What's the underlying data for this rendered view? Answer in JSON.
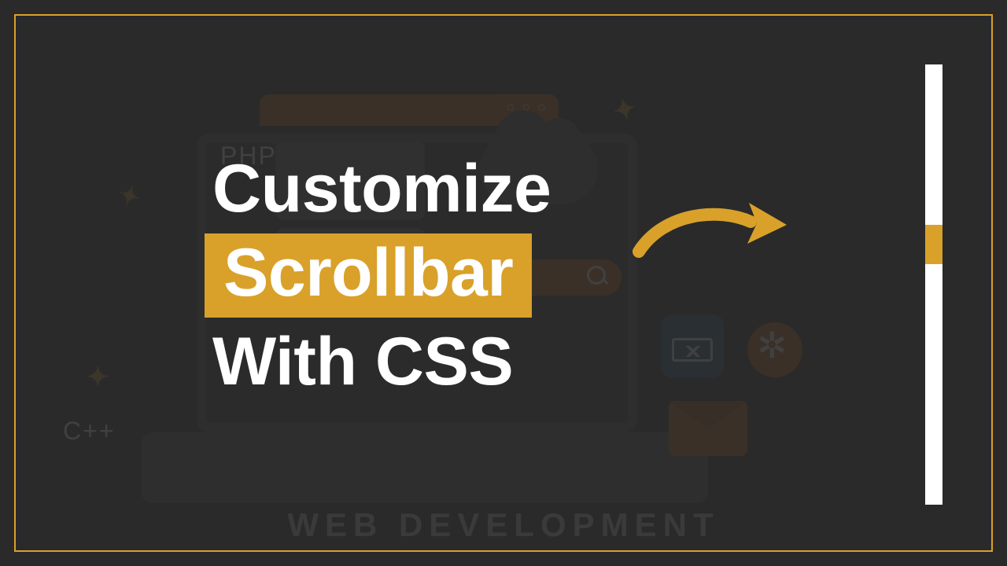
{
  "title": {
    "line1": "Customize",
    "highlight": "Scrollbar",
    "line3": "With CSS"
  },
  "bg": {
    "search_label": "Search",
    "php_label": "PHP",
    "cpp_label": "C++",
    "footer_label": "WEB DEVELOPMENT"
  },
  "colors": {
    "accent": "#d9a12a",
    "page_bg": "#2a2a2a",
    "text": "#ffffff"
  },
  "scrollbar": {
    "track_color": "#ffffff",
    "thumb_color": "#d9a12a"
  }
}
